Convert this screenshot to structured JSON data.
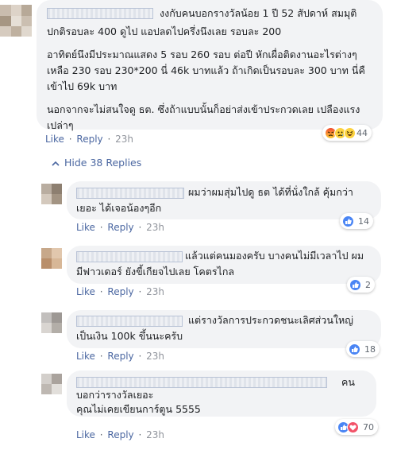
{
  "comment": {
    "lines": [
      "งงกับคนบอกรางวัลน้อย 1 ปี 52 สัปดาห์ สมมุติ",
      "ปกติรอบละ 400 ดูไป แอปลดไปครึ่งนึงเลย รอบละ 200",
      "อาทิตย์นึงมีประมาณแสดง 5 รอบ 260 รอบ ต่อปี หักเผื่อติดงานอะไรต่างๆ",
      "เหลือ 230 รอบ 230*200 นี่ 46k บาทแล้ว ถ้าเกิดเป็นรอบละ 300 บาท นี่คื",
      "เข้าไป 69k บาท",
      "นอกจากจะไม่สนใจดู ธต. ซึ่งถ้าแบบนั้นก็อย่าส่งเข้าประกวดเลย เปลืองแรง",
      "เปล่าๆ"
    ],
    "like_label": "Like",
    "reply_label": "Reply",
    "time": "23h",
    "reaction_count": "44"
  },
  "hide_replies_label": "Hide 38 Replies",
  "replies": [
    {
      "lines": [
        "ผมว่าผมสุ่มไปดู ธต ได้ที่นั่งใกล้ คุ้มกว่า",
        "เยอะ ได้เจอน้องๆอีก"
      ],
      "like_label": "Like",
      "reply_label": "Reply",
      "time": "23h",
      "reaction_count": "14"
    },
    {
      "lines": [
        "แล้วแต่คนมองครับ บางคนไม่มีเวลาไป ผม",
        "มีฟาวเดอร์ ยังขี้เกียจไปเลย โคตรไกล"
      ],
      "like_label": "Like",
      "reply_label": "Reply",
      "time": "23h",
      "reaction_count": "2"
    },
    {
      "lines": [
        "แต่รางวัลการประกวดชนะเลิศส่วนใหญ่",
        "เป็นเงิน 100k ขึ้นนะครับ"
      ],
      "like_label": "Like",
      "reply_label": "Reply",
      "time": "23h",
      "reaction_count": "18"
    },
    {
      "lines": [
        "คน",
        "บอกว่ารางวัลเยอะ",
        "คุณไม่เคยเขียนการ์ตูน 5555"
      ],
      "like_label": "Like",
      "reply_label": "Reply",
      "time": "23h",
      "reaction_count": "70"
    }
  ],
  "colors": {
    "link": "#4b67a1",
    "bubble": "#f2f3f5",
    "timestamp": "#90949c",
    "like_reaction": "#4a85f4",
    "love_reaction": "#f25268"
  }
}
